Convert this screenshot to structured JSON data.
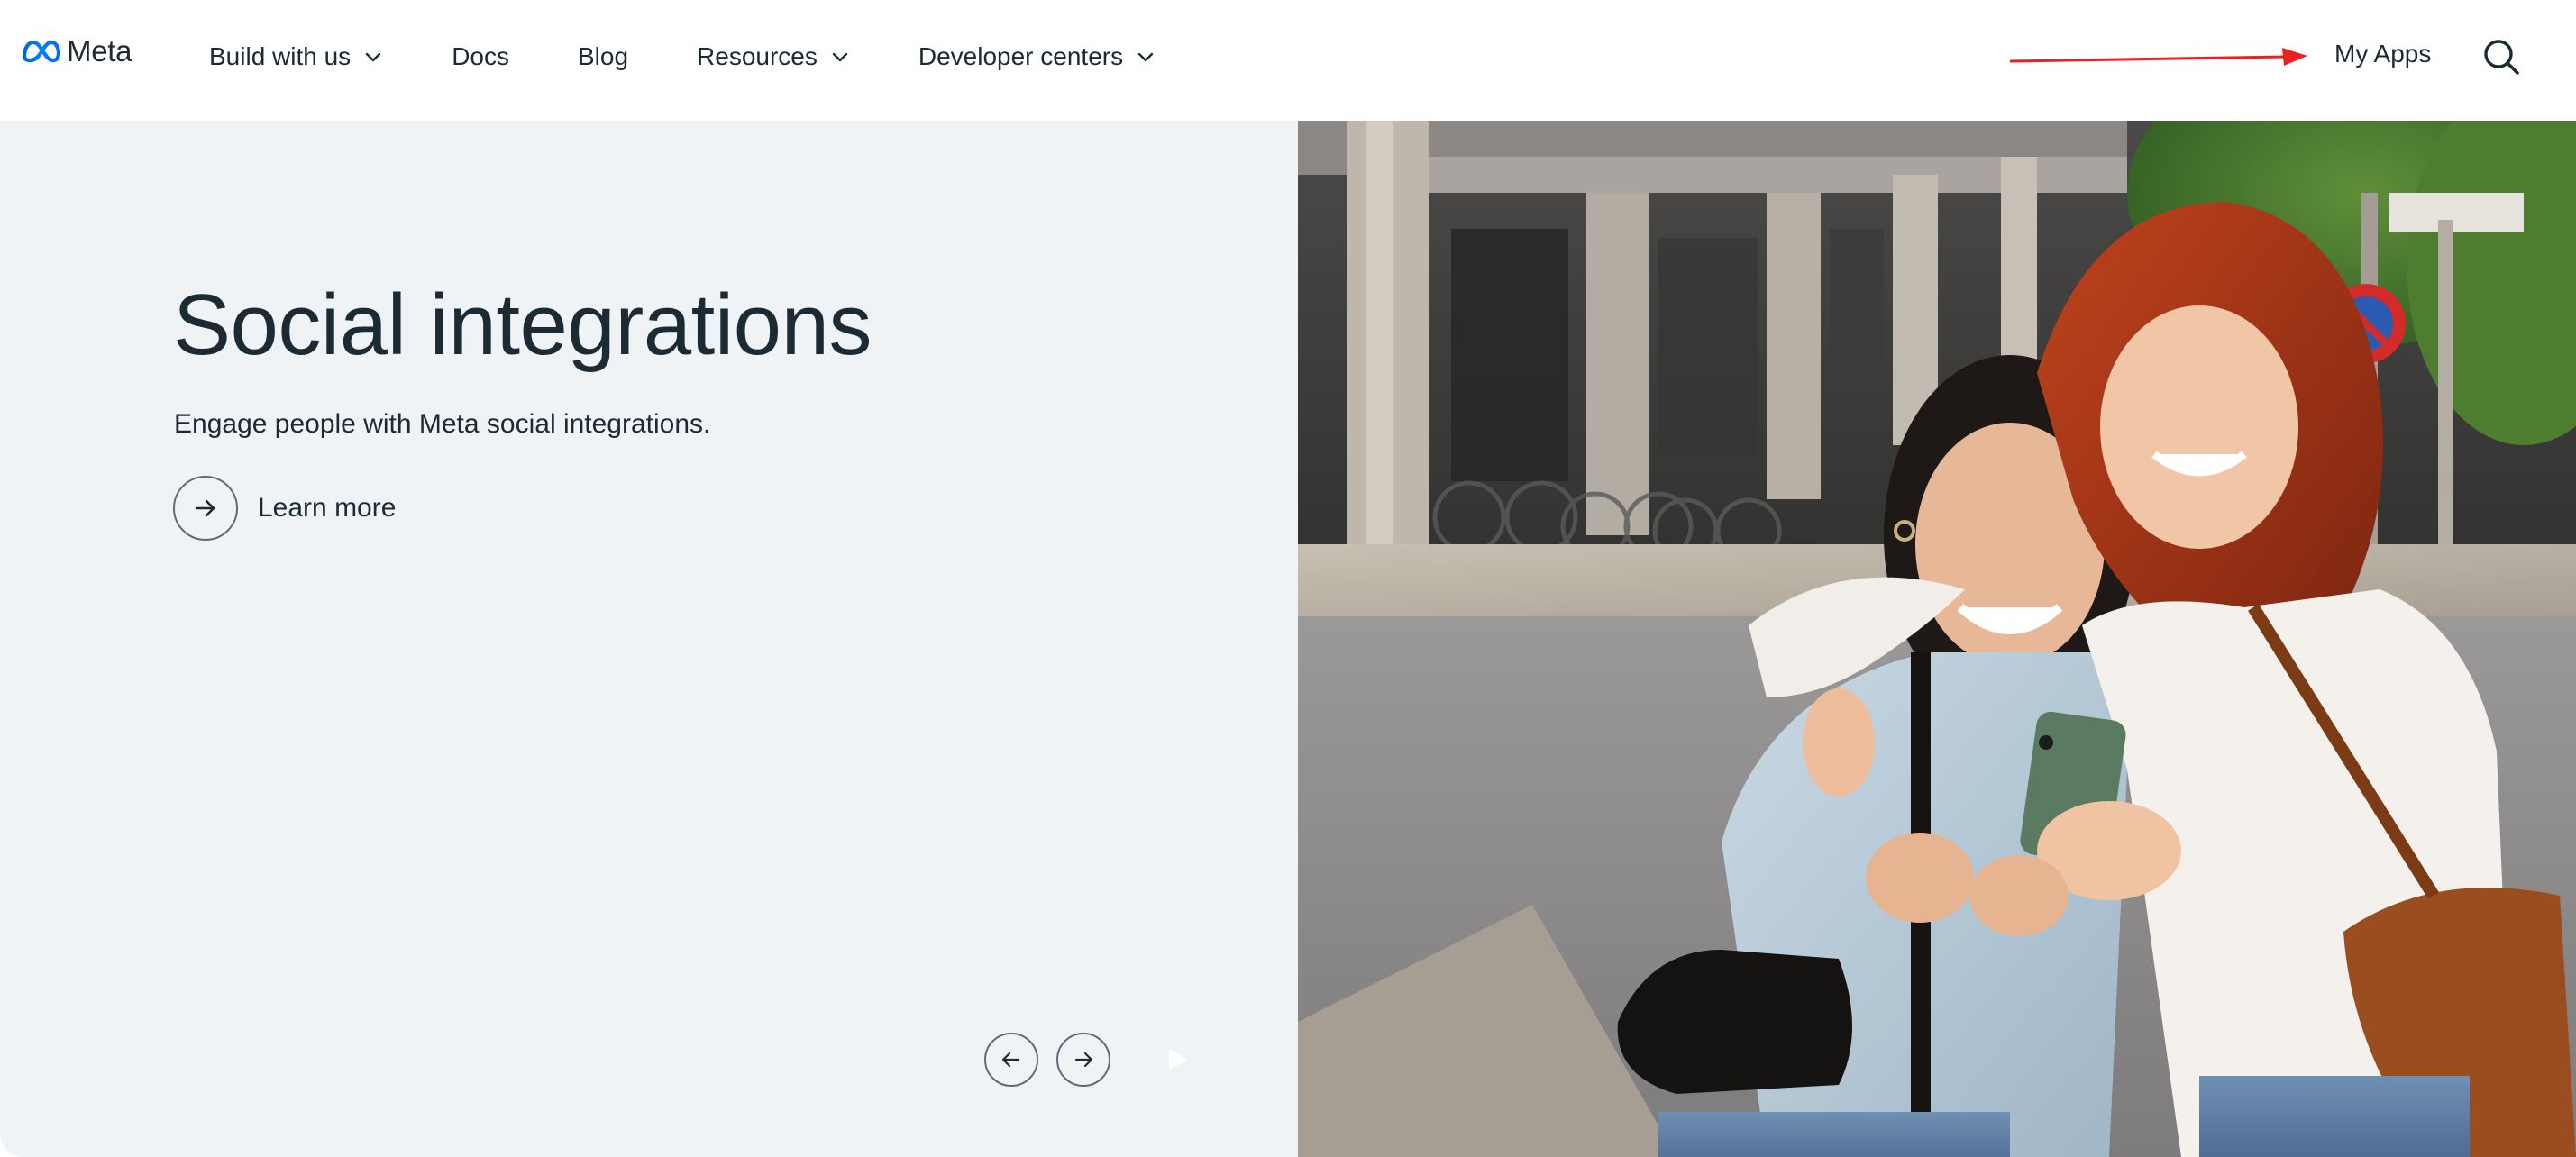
{
  "brand": {
    "name": "Meta",
    "color": "#0866ff"
  },
  "nav": {
    "items": [
      {
        "label": "Build with us",
        "has_dropdown": true
      },
      {
        "label": "Docs",
        "has_dropdown": false
      },
      {
        "label": "Blog",
        "has_dropdown": false
      },
      {
        "label": "Resources",
        "has_dropdown": true
      },
      {
        "label": "Developer centers",
        "has_dropdown": true
      }
    ],
    "my_apps_label": "My Apps",
    "search_icon": "search-icon"
  },
  "annotation": {
    "arrow_color": "#e8231f",
    "points_to": "My Apps"
  },
  "hero": {
    "title": "Social integrations",
    "subtitle": "Engage people with Meta social integrations.",
    "cta_label": "Learn more",
    "background_color": "#f0f3f6",
    "image_alt": "Two women laughing while looking at a phone on a city street"
  },
  "carousel": {
    "prev_icon": "arrow-left-icon",
    "next_icon": "arrow-right-icon",
    "play_icon": "play-icon"
  }
}
